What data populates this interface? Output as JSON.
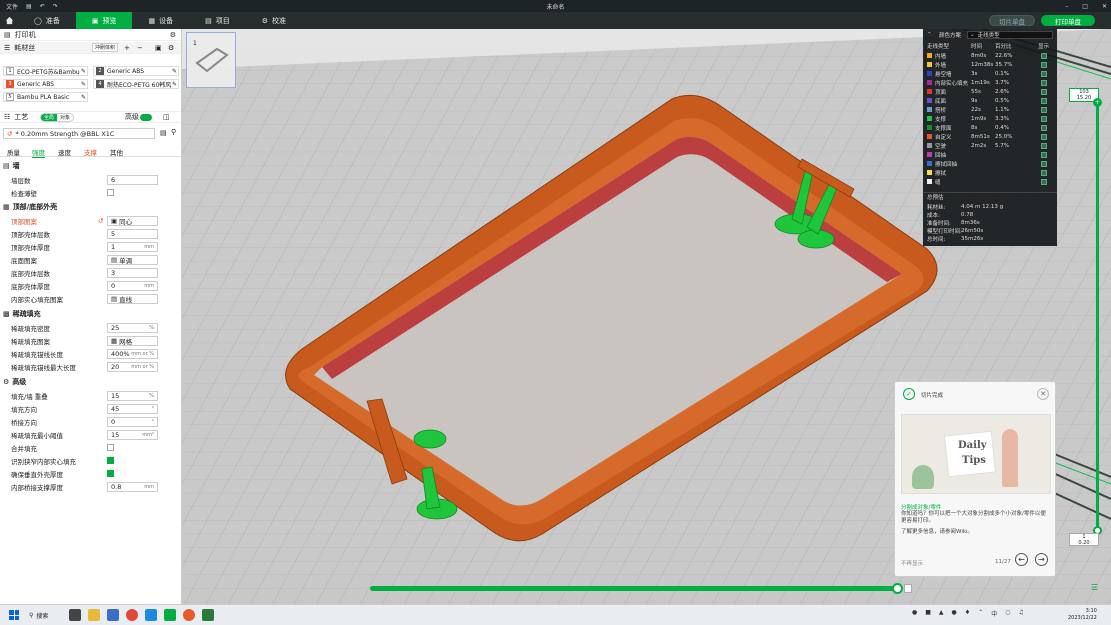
{
  "titlebar": {
    "menu_file": "文件",
    "title": "未命名"
  },
  "topbar": {
    "tabs": [
      {
        "label": "准备"
      },
      {
        "label": "预览"
      },
      {
        "label": "设备"
      },
      {
        "label": "项目"
      },
      {
        "label": "校准"
      }
    ],
    "slice_plate": "切片单盘",
    "print_plate": "打印单盘"
  },
  "printer": {
    "label": "打印机"
  },
  "filament": {
    "label": "耗材丝",
    "sync_button": "冲刷体积",
    "slots": [
      {
        "num": "1",
        "name": "ECO-PETG苏&Bambu",
        "color": "#ffffff"
      },
      {
        "num": "2",
        "name": "Generic ABS",
        "color": "#555555"
      },
      {
        "num": "3",
        "name": "Generic ABS",
        "color": "#e8522a"
      },
      {
        "num": "4",
        "name": "耐热ECO-PETG 60韩风",
        "color": "#555555"
      },
      {
        "num": "5",
        "name": "Bambu PLA Basic",
        "color": "#ffffff"
      }
    ]
  },
  "process": {
    "label": "工艺",
    "toggle_global": "全局",
    "toggle_object": "对象",
    "advanced_label": "高级",
    "preset": "* 0.20mm Strength @BBL X1C",
    "tabs": [
      "质量",
      "强度",
      "速度",
      "支撑",
      "其他"
    ],
    "groups": {
      "wall": "墙",
      "topbottom": "顶部/底部外壳",
      "infill": "稀疏填充",
      "advanced": "高级"
    },
    "rows": {
      "wall_loops": {
        "label": "墙层数",
        "value": "6"
      },
      "detect_thin": {
        "label": "检查薄壁"
      },
      "top_pattern": {
        "label": "顶部图案",
        "value": "同心"
      },
      "top_layers": {
        "label": "顶部壳体层数",
        "value": "5"
      },
      "top_thickness": {
        "label": "顶部壳体厚度",
        "value": "1",
        "unit": "mm"
      },
      "bottom_pattern": {
        "label": "底面图案",
        "value": "单调"
      },
      "bottom_layers": {
        "label": "底部壳体层数",
        "value": "3"
      },
      "bottom_thickness": {
        "label": "底部壳体厚度",
        "value": "0",
        "unit": "mm"
      },
      "internal_solid": {
        "label": "内部实心填充图案",
        "value": "直线"
      },
      "infill_density": {
        "label": "稀疏填充密度",
        "value": "25",
        "unit": "%"
      },
      "infill_pattern": {
        "label": "稀疏填充图案",
        "value": "网格"
      },
      "anchor_len": {
        "label": "稀疏填充锚线长度",
        "value": "400%",
        "unit": "mm or %"
      },
      "anchor_max": {
        "label": "稀疏填充锚线最大长度",
        "value": "20",
        "unit": "mm or %"
      },
      "infill_wall_overlap": {
        "label": "填充/墙 重叠",
        "value": "15",
        "unit": "%"
      },
      "infill_direction": {
        "label": "填充方向",
        "value": "45",
        "unit": "°"
      },
      "bridge_direction": {
        "label": "桥接方向",
        "value": "0",
        "unit": "°"
      },
      "min_area": {
        "label": "稀疏填充最小阈值",
        "value": "15",
        "unit": "mm²"
      },
      "combine_infill": {
        "label": "合并填充"
      },
      "detect_narrow": {
        "label": "识别狭窄内部实心填充"
      },
      "ensure_vertical": {
        "label": "确保垂直外壳厚度"
      },
      "bridge_support": {
        "label": "内部桥接支撑厚度",
        "value": "0.8",
        "unit": "mm"
      }
    }
  },
  "plate_thumb": {
    "number": "1"
  },
  "legend": {
    "scheme_label": "颜色方案",
    "scheme_value": "走线类型",
    "headers": [
      "走线类型",
      "时间",
      "百分比",
      "显示"
    ],
    "rows": [
      {
        "name": "内墙",
        "time": "8m0s",
        "pct": "22.6%",
        "color": "#f5a623"
      },
      {
        "name": "外墙",
        "time": "12m38s",
        "pct": "35.7%",
        "color": "#f0c93a"
      },
      {
        "name": "悬空墙",
        "time": "3s",
        "pct": "0.1%",
        "color": "#3240c8"
      },
      {
        "name": "内部实心填充",
        "time": "1m19s",
        "pct": "3.7%",
        "color": "#9c2f9c"
      },
      {
        "name": "顶面",
        "time": "55s",
        "pct": "2.6%",
        "color": "#e0362c"
      },
      {
        "name": "底面",
        "time": "9s",
        "pct": "0.5%",
        "color": "#6e4bd8"
      },
      {
        "name": "搭桥",
        "time": "22s",
        "pct": "1.1%",
        "color": "#6aa0c8"
      },
      {
        "name": "支撑",
        "time": "1m9s",
        "pct": "3.3%",
        "color": "#1fc53a"
      },
      {
        "name": "支撑面",
        "time": "8s",
        "pct": "0.4%",
        "color": "#1b8a2b"
      },
      {
        "name": "自定义",
        "time": "8m51s",
        "pct": "25.0%",
        "color": "#e8552c"
      },
      {
        "name": "空驶",
        "time": "2m2s",
        "pct": "5.7%",
        "color": "#999999"
      },
      {
        "name": "回抽",
        "time": "",
        "pct": "",
        "color": "#c236b0"
      },
      {
        "name": "擦拭回抽",
        "time": "",
        "pct": "",
        "color": "#3b6ec8"
      },
      {
        "name": "擦拭",
        "time": "",
        "pct": "",
        "color": "#f2e04a"
      },
      {
        "name": "缝",
        "time": "",
        "pct": "",
        "color": "#eeeeee"
      }
    ],
    "summary_label": "总预估",
    "summary": [
      {
        "k": "耗材丝:",
        "v": "4.04 m    12.13 g"
      },
      {
        "k": "成本:",
        "v": "0.78"
      },
      {
        "k": "准备时间:",
        "v": "8m36s"
      },
      {
        "k": "模型打印时间:",
        "v": "26m50s"
      },
      {
        "k": "总时间:",
        "v": "35m26s"
      }
    ]
  },
  "vslider": {
    "top_layer": "103",
    "top_height": "15.20",
    "bottom_layer": "1",
    "bottom_height": "0.20"
  },
  "tips": {
    "header": "切片完成",
    "image_title_1": "Daily",
    "image_title_2": "Tips",
    "topic": "分割成对象/零件",
    "body": "你知道吗？你可以把一个大对象分割成多个小对象/零件以便更容易打印。",
    "more": "了解更多信息，请参阅Wiki。",
    "dont_show": "不再显示",
    "page": "11/27"
  },
  "taskbar": {
    "search": "搜索",
    "time": "3:10",
    "date": "2023/12/22"
  }
}
